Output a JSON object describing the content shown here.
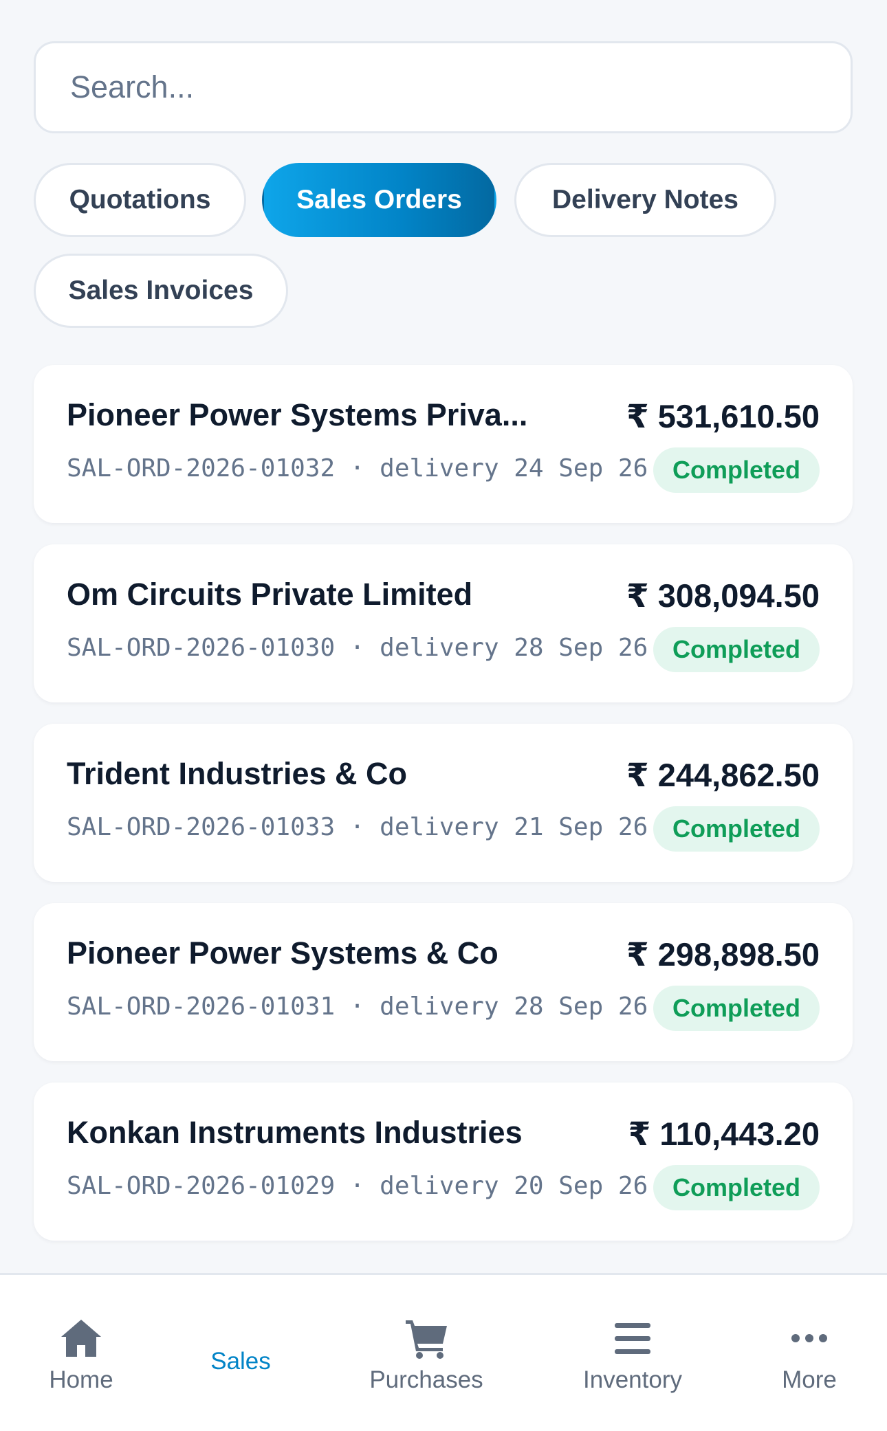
{
  "search": {
    "placeholder": "Search..."
  },
  "tabs": [
    {
      "label": "Quotations",
      "active": false
    },
    {
      "label": "Sales Orders",
      "active": true
    },
    {
      "label": "Delivery Notes",
      "active": false
    },
    {
      "label": "Sales Invoices",
      "active": false
    }
  ],
  "orders": [
    {
      "customer": "Pioneer Power Systems Priva...",
      "amount": "₹ 531,610.50",
      "meta": "SAL-ORD-2026-01032 · delivery 24 Sep 26",
      "status": "Completed"
    },
    {
      "customer": "Om Circuits Private Limited",
      "amount": "₹ 308,094.50",
      "meta": "SAL-ORD-2026-01030 · delivery 28 Sep 26",
      "status": "Completed"
    },
    {
      "customer": "Trident Industries & Co",
      "amount": "₹ 244,862.50",
      "meta": "SAL-ORD-2026-01033 · delivery 21 Sep 26",
      "status": "Completed"
    },
    {
      "customer": "Pioneer Power Systems & Co",
      "amount": "₹ 298,898.50",
      "meta": "SAL-ORD-2026-01031 · delivery 28 Sep 26",
      "status": "Completed"
    },
    {
      "customer": "Konkan Instruments Industries",
      "amount": "₹ 110,443.20",
      "meta": "SAL-ORD-2026-01029 · delivery 20 Sep 26",
      "status": "Completed"
    }
  ],
  "nav": [
    {
      "label": "Home",
      "icon": "home-icon",
      "active": false
    },
    {
      "label": "Sales",
      "icon": "",
      "active": true
    },
    {
      "label": "Purchases",
      "icon": "cart-icon",
      "active": false
    },
    {
      "label": "Inventory",
      "icon": "menu-icon",
      "active": false
    },
    {
      "label": "More",
      "icon": "more-icon",
      "active": false
    }
  ],
  "colors": {
    "accent": "#0284c7",
    "status_bg": "#e3f6ee",
    "status_text": "#0f9d58",
    "background": "#f5f7fa"
  }
}
